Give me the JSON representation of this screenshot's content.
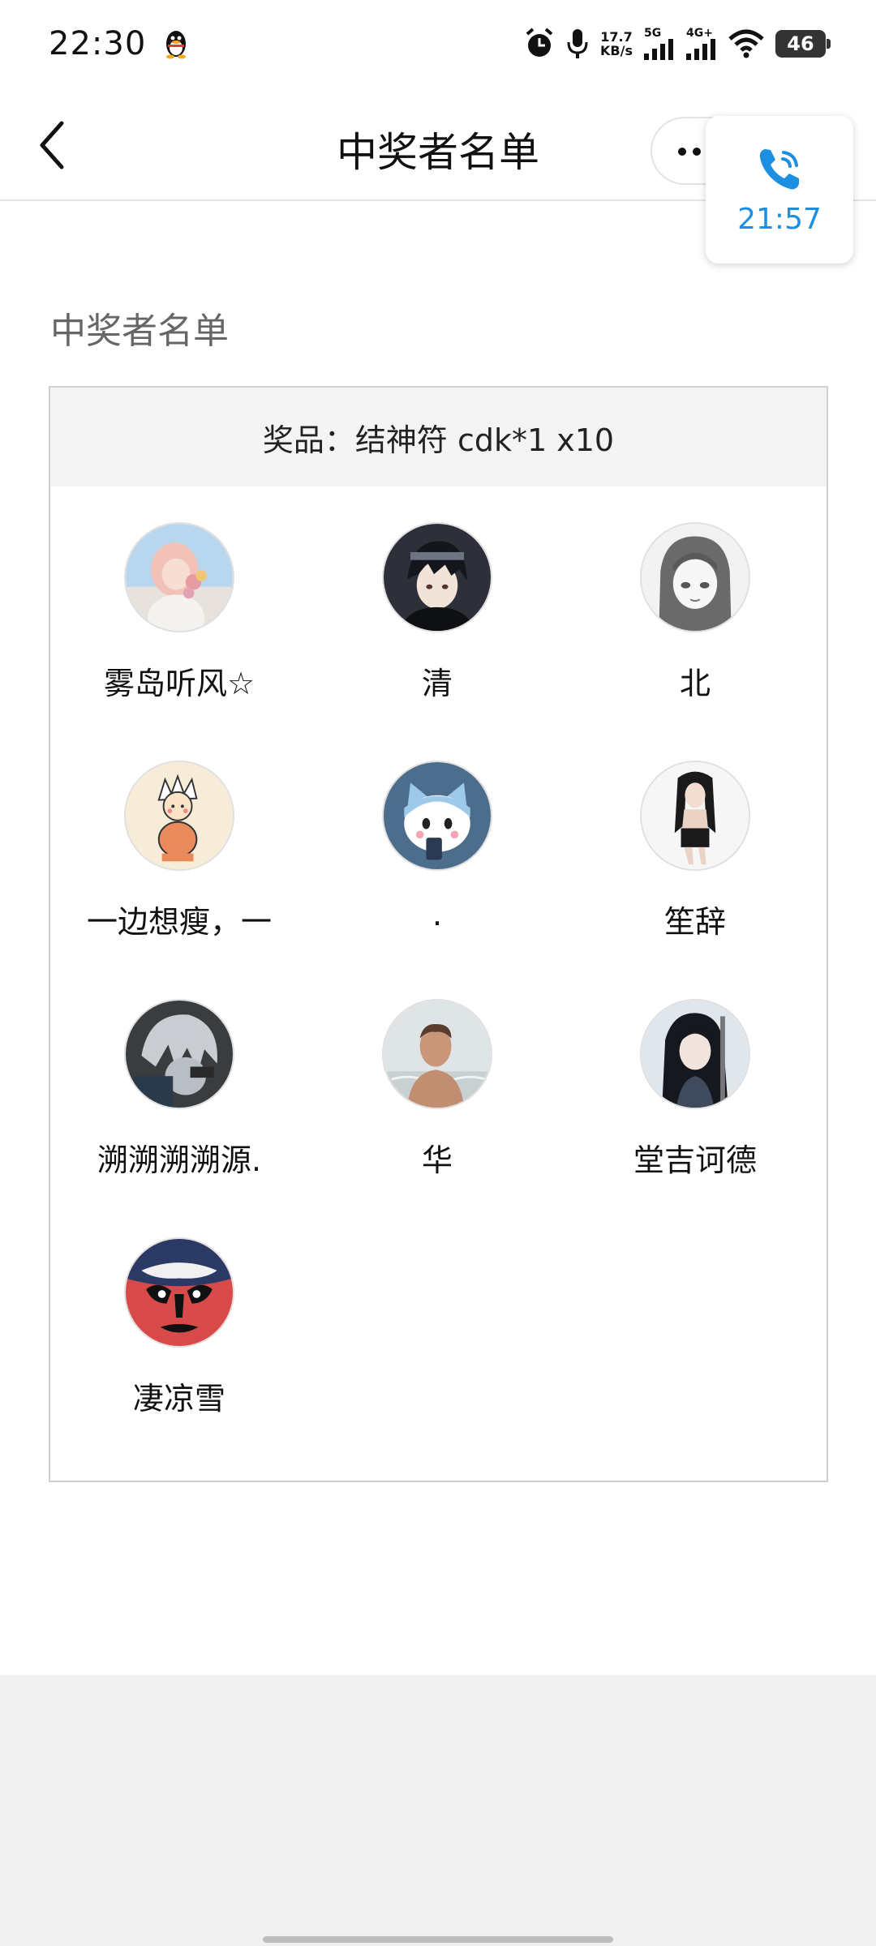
{
  "status_bar": {
    "time": "22:30",
    "net_speed_value": "17.7",
    "net_speed_unit": "KB/s",
    "sim1_label": "5G",
    "sim2_label": "4G+",
    "battery": "46"
  },
  "nav": {
    "title": "中奖者名单"
  },
  "call_widget": {
    "time": "21:57",
    "accent": "#1d8fe1"
  },
  "content": {
    "section_heading": "中奖者名单",
    "prize_label": "奖品：结神符 cdk*1 x10",
    "winners": [
      {
        "name": "雾岛听风☆",
        "avatar": "girl-flowers-avatar"
      },
      {
        "name": "清",
        "avatar": "dark-hair-boy-avatar"
      },
      {
        "name": "北",
        "avatar": "sketch-girl-avatar"
      },
      {
        "name": "一边想瘦，一",
        "avatar": "cartoon-kid-avatar"
      },
      {
        "name": ".",
        "avatar": "blue-cat-avatar"
      },
      {
        "name": "笙辞",
        "avatar": "dark-hair-woman-avatar"
      },
      {
        "name": "溯溯溯溯源.",
        "avatar": "white-hair-ninja-avatar"
      },
      {
        "name": "华",
        "avatar": "man-in-water-avatar"
      },
      {
        "name": "堂吉诃德",
        "avatar": "long-hair-swordsman-avatar"
      },
      {
        "name": "凄凉雪",
        "avatar": "opera-mask-avatar"
      }
    ]
  }
}
